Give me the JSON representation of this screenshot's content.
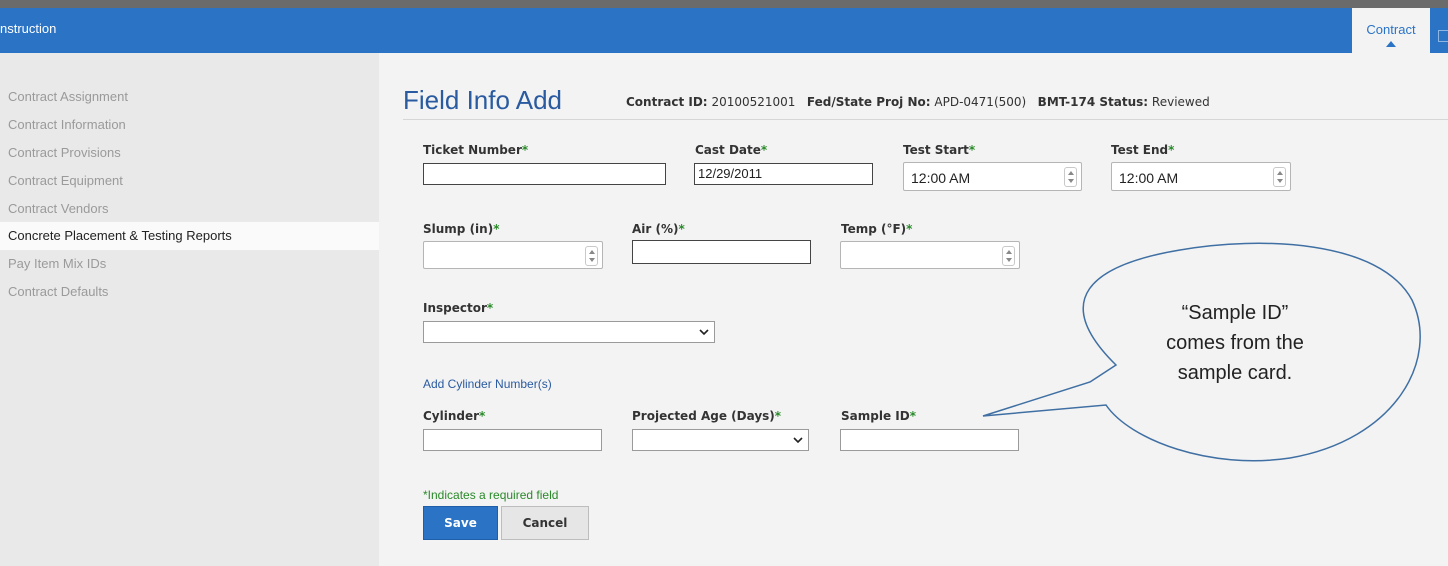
{
  "header": {
    "app_title": "nstruction",
    "tab_contract": "Contract"
  },
  "sidebar": {
    "items": [
      {
        "label": "Contract Assignment"
      },
      {
        "label": "Contract Information"
      },
      {
        "label": "Contract Provisions"
      },
      {
        "label": "Contract Equipment"
      },
      {
        "label": "Contract Vendors"
      },
      {
        "label": "Concrete Placement & Testing Reports"
      },
      {
        "label": "Pay Item Mix IDs"
      },
      {
        "label": "Contract Defaults"
      }
    ]
  },
  "page": {
    "title": "Field Info Add",
    "contract_id_label": "Contract ID:",
    "contract_id": "20100521001",
    "proj_label": "Fed/State Proj No:",
    "proj_no": "APD-0471(500)",
    "status_label": "BMT-174 Status:",
    "status": "Reviewed"
  },
  "form": {
    "required_mark": "*",
    "ticket_number": {
      "label": "Ticket Number",
      "value": ""
    },
    "cast_date": {
      "label": "Cast Date",
      "value": "12/29/2011"
    },
    "test_start": {
      "label": "Test Start",
      "value": "12:00 AM"
    },
    "test_end": {
      "label": "Test End",
      "value": "12:00 AM"
    },
    "slump": {
      "label": "Slump (in)",
      "value": ""
    },
    "air": {
      "label": "Air (%)",
      "value": ""
    },
    "temp": {
      "label": "Temp (°F)",
      "value": ""
    },
    "inspector": {
      "label": "Inspector",
      "value": ""
    },
    "add_cylinder_link": "Add Cylinder Number(s)",
    "cylinder": {
      "label": "Cylinder",
      "value": ""
    },
    "projected_age": {
      "label": "Projected Age (Days)",
      "value": ""
    },
    "sample_id": {
      "label": "Sample ID",
      "value": ""
    },
    "required_note": "*Indicates a required field",
    "save_label": "Save",
    "cancel_label": "Cancel"
  },
  "callout": {
    "line1": "“Sample ID”",
    "line2": "comes from the",
    "line3": "sample card."
  }
}
